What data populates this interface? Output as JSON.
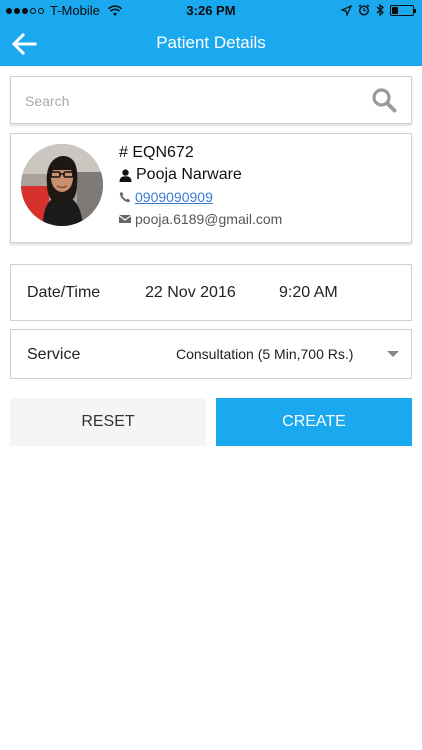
{
  "status_bar": {
    "carrier": "T-Mobile",
    "time": "3:26 PM",
    "signal_bars_filled": 3,
    "signal_bars_total": 5,
    "battery_level": 0.3
  },
  "app_bar": {
    "title": "Patient Details",
    "back_icon": "arrow-left-icon"
  },
  "search": {
    "placeholder": "Search",
    "value": "",
    "icon": "search-icon"
  },
  "patient": {
    "id": "# EQN672",
    "name": "Pooja Narware",
    "phone": "0909090909",
    "email": "pooja.6189@gmail.com",
    "icons": {
      "name": "person-icon",
      "phone": "phone-icon",
      "email": "envelope-icon"
    }
  },
  "appointment": {
    "datetime_label": "Date/Time",
    "date": "22 Nov 2016",
    "time": "9:20 AM",
    "service_label": "Service",
    "service_value": "Consultation (5 Min,700 Rs.)"
  },
  "actions": {
    "reset_label": "RESET",
    "create_label": "CREATE"
  },
  "colors": {
    "primary": "#1aa8ee",
    "link": "#3a7bd5",
    "reset_bg": "#f5f5f5"
  }
}
